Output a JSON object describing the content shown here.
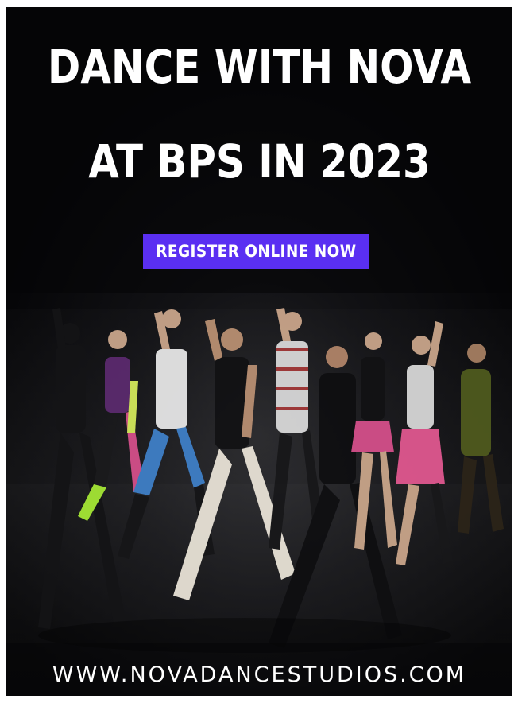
{
  "poster": {
    "headline_line1": "DANCE WITH NOVA",
    "headline_line2": "AT BPS IN 2023",
    "register_button_label": "REGISTER ONLINE NOW",
    "website": "WWW.NOVADANCESTUDIOS.COM",
    "photo_icon": "dancers-photo",
    "colors": {
      "background": "#050507",
      "button": "#5a2ff2",
      "text": "#ffffff"
    }
  }
}
